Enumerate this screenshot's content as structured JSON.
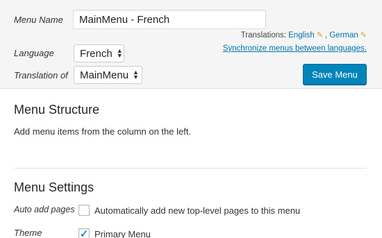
{
  "menu_form": {
    "menu_name_label": "Menu Name",
    "menu_name_value": "MainMenu - French",
    "language_label": "Language",
    "language_value": "French",
    "translation_of_label": "Translation of",
    "translation_of_value": "MainMenu",
    "translations_prefix": "Translations:",
    "translations": [
      {
        "label": "English",
        "icon": "pencil-icon"
      },
      {
        "label": "German",
        "icon": "pencil-icon"
      }
    ],
    "sync_link": "Synchronize menus between languages.",
    "save_button": "Save Menu"
  },
  "menu_structure": {
    "title": "Menu Structure",
    "description": "Add menu items from the column on the left."
  },
  "menu_settings": {
    "title": "Menu Settings",
    "auto_add_label": "Auto add pages",
    "auto_add_option": "Automatically add new top-level pages to this menu",
    "auto_add_checked": false,
    "theme_label": "Theme",
    "theme_option": "Primary Menu",
    "theme_checked": true
  },
  "colors": {
    "accent": "#0085ba",
    "link": "#0073aa",
    "panel_bg": "#f5f5f5",
    "pencil": "#d4a326"
  }
}
